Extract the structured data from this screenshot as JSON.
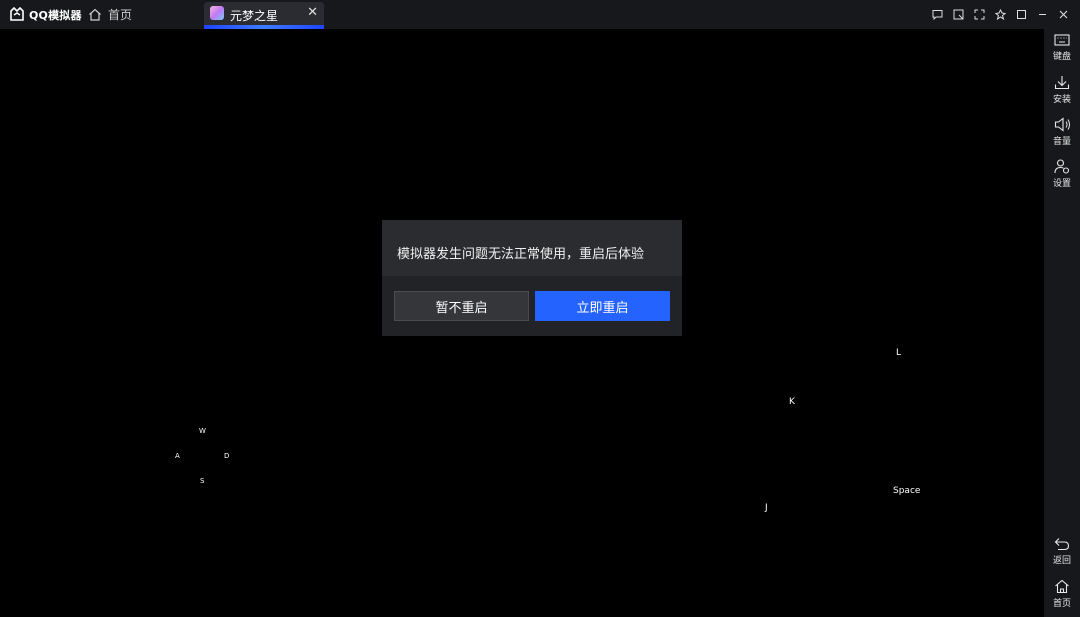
{
  "app": {
    "name": "QQ模拟器"
  },
  "tabs": {
    "home_label": "首页",
    "game_label": "元梦之星",
    "close_glyph": "✕"
  },
  "sidebar": {
    "keyboard_label": "键盘",
    "install_label": "安装",
    "volume_label": "音量",
    "settings_label": "设置",
    "back_label": "返回",
    "home_label": "首页"
  },
  "keys": {
    "w": "W",
    "a": "A",
    "s": "S",
    "d": "D",
    "l": "L",
    "k": "K",
    "j": "J",
    "space": "Space"
  },
  "dialog": {
    "message": "模拟器发生问题无法正常使用，重启后体验",
    "cancel_label": "暂不重启",
    "confirm_label": "立即重启"
  },
  "colors": {
    "accent": "#2563ff",
    "titlebar": "#17181b",
    "dialog": "#2b2c30"
  }
}
